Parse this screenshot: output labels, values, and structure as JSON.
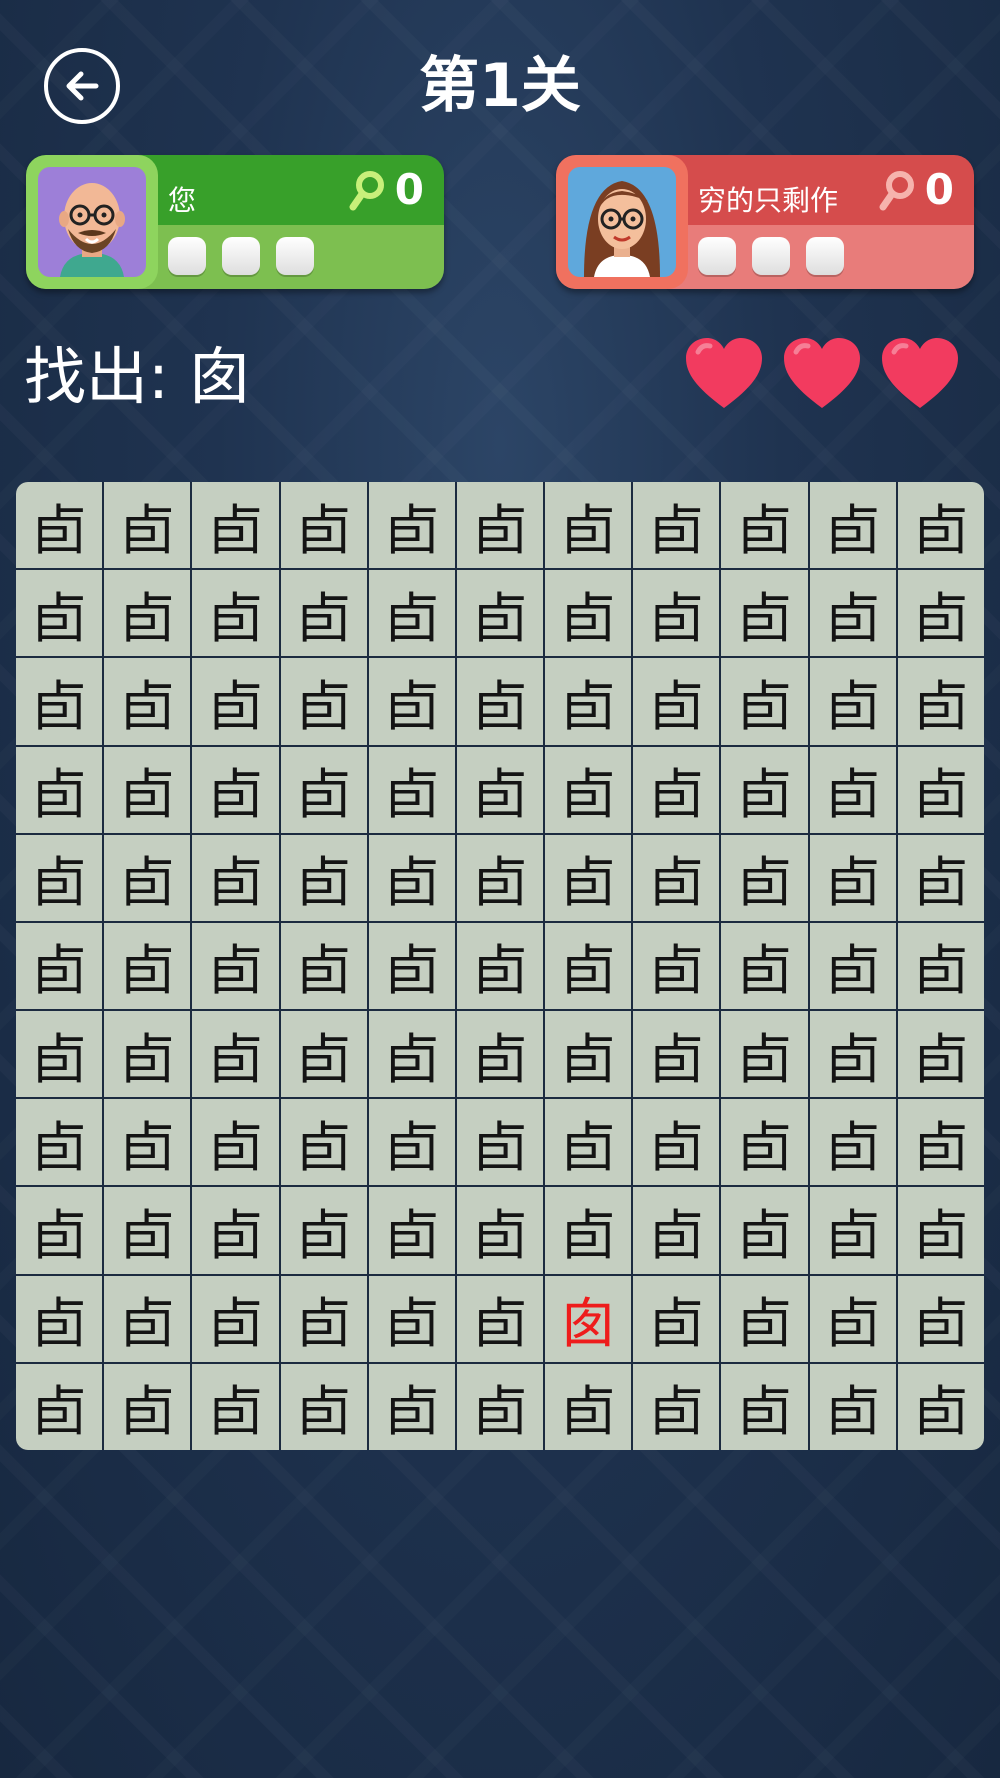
{
  "header": {
    "title": "第1关"
  },
  "players": {
    "you": {
      "name": "您",
      "score": "0",
      "colors": {
        "top": "#38a02a",
        "bottom": "#7dbf50",
        "frame": "#8ed45e"
      }
    },
    "rival": {
      "name": "穷的只剩作",
      "score": "0",
      "colors": {
        "top": "#d54c4c",
        "bottom": "#e87c7a",
        "frame": "#f0715f"
      }
    }
  },
  "prompt": {
    "label": "找出: 囱"
  },
  "lives": {
    "count": 3,
    "icon": "heart-icon",
    "color": "#f23b5f"
  },
  "grid": {
    "rows": 11,
    "cols": 11,
    "common_char": "卣",
    "target_char": "囱",
    "target_row": 10,
    "target_col": 7,
    "target_color": "#ee1c1c"
  }
}
